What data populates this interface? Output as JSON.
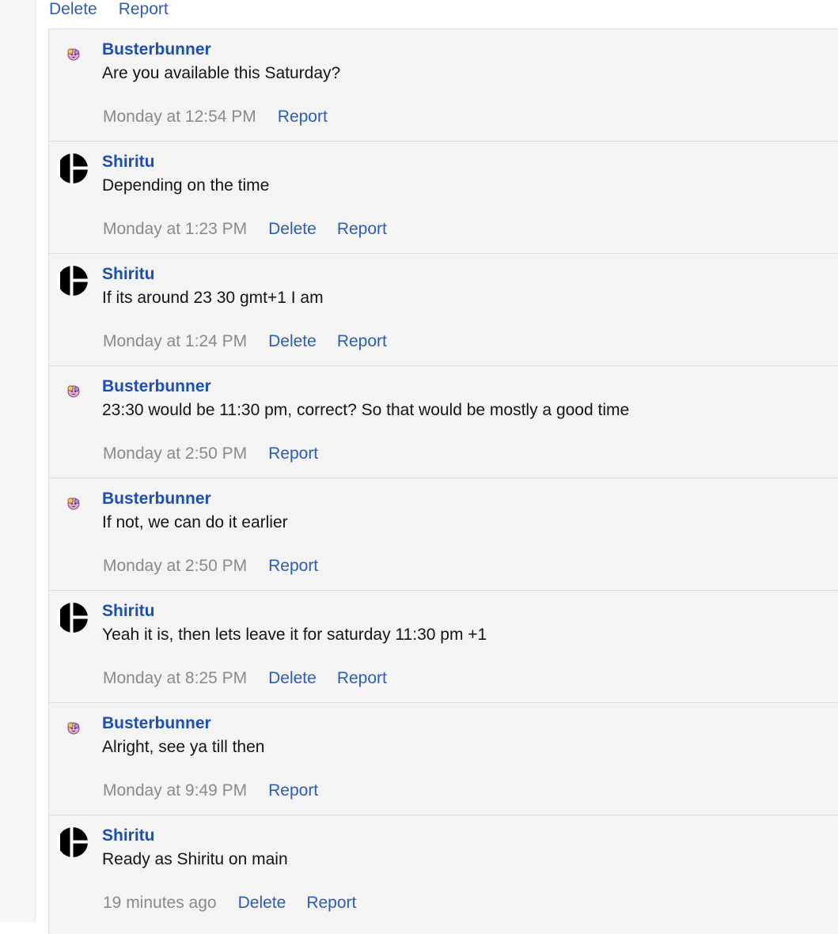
{
  "top_actions": {
    "delete_label": "Delete",
    "report_label": "Report"
  },
  "messages": [
    {
      "author": "Busterbunner",
      "avatar": "pink-creature-icon",
      "text": "Are you available this Saturday?",
      "time": "Monday at 12:54 PM",
      "actions": [
        "Report"
      ]
    },
    {
      "author": "Shiritu",
      "avatar": "smash-logo-icon",
      "text": "Depending on the time",
      "time": "Monday at 1:23 PM",
      "actions": [
        "Delete",
        "Report"
      ]
    },
    {
      "author": "Shiritu",
      "avatar": "smash-logo-icon",
      "text": "If its around 23 30 gmt+1 I am",
      "time": "Monday at 1:24 PM",
      "actions": [
        "Delete",
        "Report"
      ]
    },
    {
      "author": "Busterbunner",
      "avatar": "pink-creature-icon",
      "text": "23:30 would be 11:30 pm, correct? So that would be mostly a good time",
      "time": "Monday at 2:50 PM",
      "actions": [
        "Report"
      ]
    },
    {
      "author": "Busterbunner",
      "avatar": "pink-creature-icon",
      "text": "If not, we can do it earlier",
      "time": "Monday at 2:50 PM",
      "actions": [
        "Report"
      ]
    },
    {
      "author": "Shiritu",
      "avatar": "smash-logo-icon",
      "text": "Yeah it is, then lets leave it for saturday 11:30 pm +1",
      "time": "Monday at 8:25 PM",
      "actions": [
        "Delete",
        "Report"
      ]
    },
    {
      "author": "Busterbunner",
      "avatar": "pink-creature-icon",
      "text": "Alright, see ya till then",
      "time": "Monday at 9:49 PM",
      "actions": [
        "Report"
      ]
    },
    {
      "author": "Shiritu",
      "avatar": "smash-logo-icon",
      "text": "Ready as Shiritu on main",
      "time": "19 minutes ago",
      "actions": [
        "Delete",
        "Report"
      ]
    }
  ]
}
